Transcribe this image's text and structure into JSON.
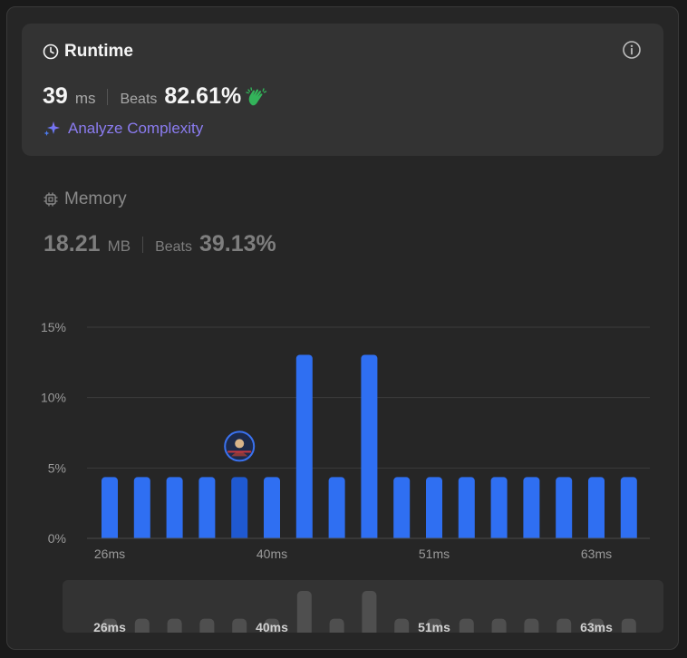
{
  "runtime": {
    "title": "Runtime",
    "value": "39",
    "unit": "ms",
    "beats_label": "Beats",
    "beats_value": "82.61%",
    "analyze_label": "Analyze Complexity"
  },
  "memory": {
    "title": "Memory",
    "value": "18.21",
    "unit": "MB",
    "beats_label": "Beats",
    "beats_value": "39.13%"
  },
  "colors": {
    "bar": "#2f6ff2",
    "bar_selected": "#1f59d1",
    "accent_purple": "#8b7cf0",
    "clap_green": "#33b35a"
  },
  "icons": {
    "runtime": "clock-icon",
    "info": "info-icon",
    "analyze": "sparkle-icon",
    "memory": "chip-icon",
    "clap": "clapping-hands-icon"
  },
  "chart_data": {
    "type": "bar",
    "y_tick_labels": [
      "0%",
      "5%",
      "10%",
      "15%"
    ],
    "x_tick_labels": [
      "26ms",
      "40ms",
      "51ms",
      "63ms"
    ],
    "ylim": [
      0,
      15
    ],
    "values": [
      4.35,
      4.35,
      4.35,
      4.35,
      4.35,
      4.35,
      13.04,
      4.35,
      13.04,
      4.35,
      4.35,
      4.35,
      4.35,
      4.35,
      4.35,
      4.35,
      4.35
    ],
    "selected_index": 4,
    "grid": true
  }
}
